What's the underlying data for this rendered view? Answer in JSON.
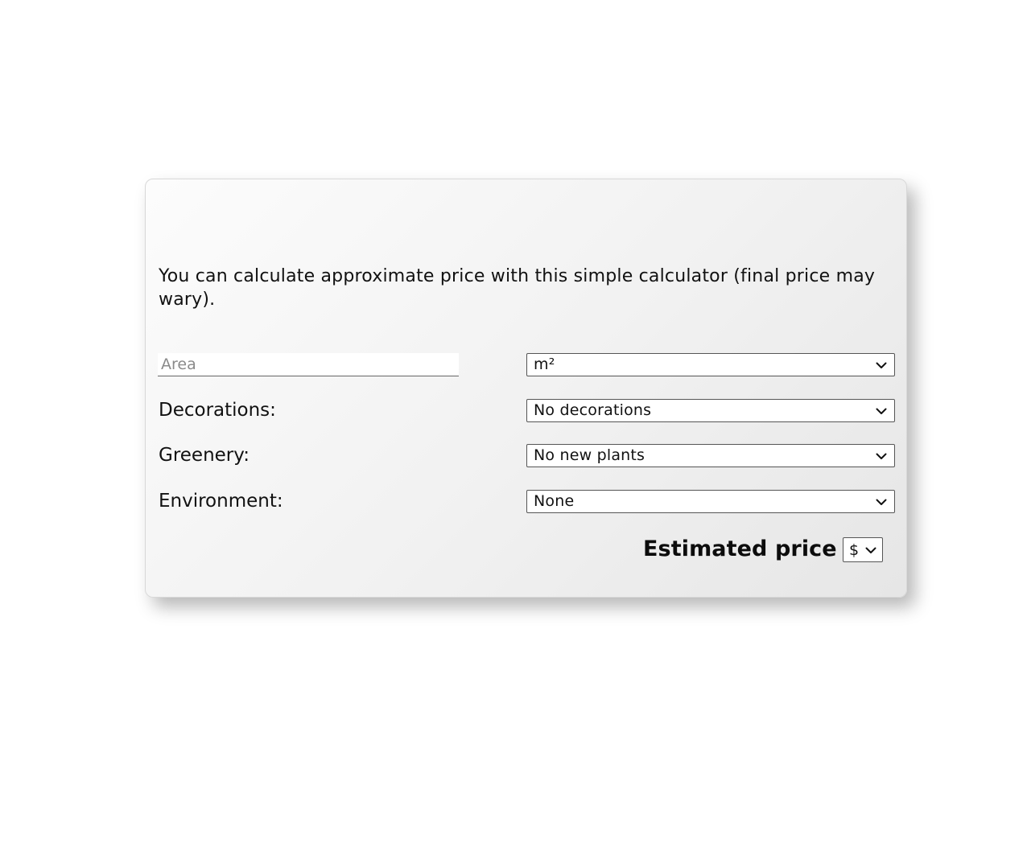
{
  "calculator": {
    "intro": "You can calculate approximate price with this simple calculator (final price may wary).",
    "area": {
      "placeholder": "Area",
      "value": "",
      "unit_selected": "m²"
    },
    "rows": [
      {
        "label": "Decorations:",
        "selected": "No decorations"
      },
      {
        "label": "Greenery:",
        "selected": "No new plants"
      },
      {
        "label": "Environment:",
        "selected": "None"
      }
    ],
    "price": {
      "label": "Estimated price",
      "currency_selected": "$"
    }
  },
  "icons": {
    "select_arrow": "chevron-down-icon"
  }
}
